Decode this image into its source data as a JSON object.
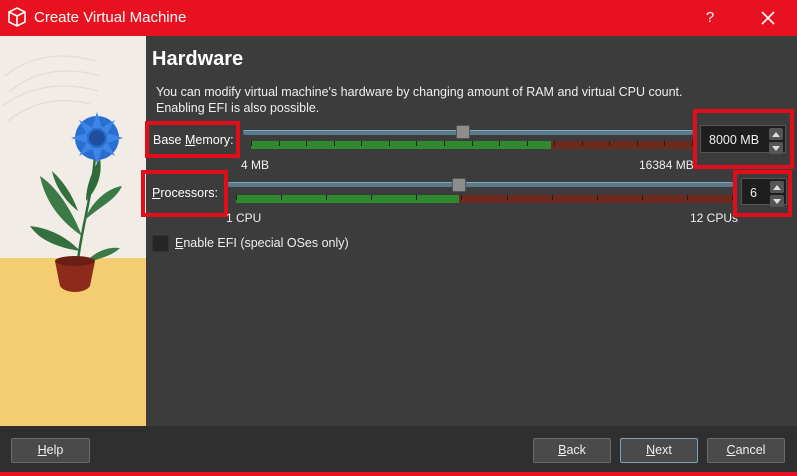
{
  "window": {
    "title": "Create Virtual Machine",
    "help_glyph": "?"
  },
  "page": {
    "title": "Hardware",
    "description_line1": "You can modify virtual machine's hardware by changing amount of RAM and virtual CPU count.",
    "description_line2": "Enabling EFI is also possible."
  },
  "memory": {
    "label_prefix": "Base ",
    "label_mnemonic": "M",
    "label_suffix": "emory:",
    "min_label": "4 MB",
    "max_label": "16384 MB",
    "value": "8000 MB",
    "value_mb": 8000,
    "min_mb": 4,
    "max_mb": 16384
  },
  "processors": {
    "label_prefix": "",
    "label_mnemonic": "P",
    "label_suffix": "rocessors:",
    "min_label": "1 CPU",
    "max_label": "12 CPUs",
    "value": "6",
    "value_num": 6,
    "min": 1,
    "max": 12
  },
  "efi": {
    "label_mnemonic": "E",
    "label_rest": "nable EFI (special OSes only)",
    "checked": false
  },
  "buttons": {
    "help_mnemonic": "H",
    "help_rest": "elp",
    "back_mnemonic": "B",
    "back_rest": "ack",
    "next_mnemonic": "N",
    "next_rest": "ext",
    "cancel_mnemonic": "C",
    "cancel_rest": "ancel"
  },
  "colors": {
    "accent_red": "#e8111f",
    "highlight_box": "#e00d1b",
    "scale_green": "#2f8a2f",
    "scale_red": "#7a2a1e"
  }
}
